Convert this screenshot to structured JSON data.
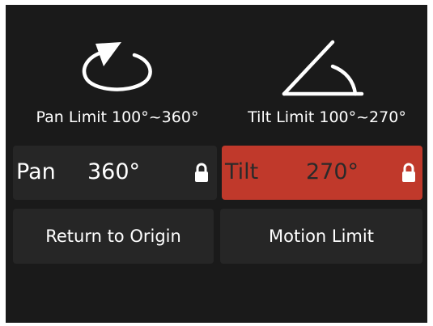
{
  "icons": {
    "pan": "pan-rotation-icon",
    "tilt": "tilt-angle-icon",
    "lock": "lock-icon"
  },
  "pan": {
    "limit_label": "Pan Limit 100°~360°",
    "name": "Pan",
    "value": "360°"
  },
  "tilt": {
    "limit_label": "Tilt Limit 100°~270°",
    "name": "Tilt",
    "value": "270°"
  },
  "buttons": {
    "return_to_origin": "Return to Origin",
    "motion_limit": "Motion Limit"
  },
  "colors": {
    "background": "#1a1a1a",
    "panel": "#262626",
    "active_panel": "#c0392b",
    "text": "#ffffff"
  }
}
